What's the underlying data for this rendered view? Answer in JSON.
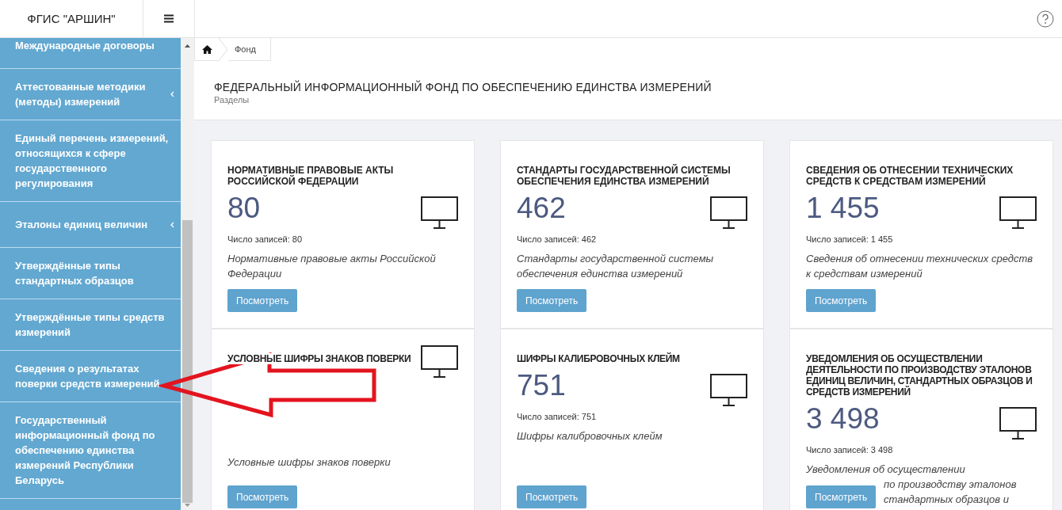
{
  "header": {
    "brand": "ФГИС \"АРШИН\""
  },
  "sidebar": {
    "items": [
      {
        "label": "Международные договоры",
        "has_submenu": false
      },
      {
        "label": "Аттестованные методики (методы) измерений",
        "has_submenu": true
      },
      {
        "label": "Единый перечень измерений, относящихся к сфере государственного регулирования",
        "has_submenu": false
      },
      {
        "label": "Эталоны единиц величин",
        "has_submenu": true
      },
      {
        "label": "Утверждённые типы стандартных образцов",
        "has_submenu": false
      },
      {
        "label": "Утверждённые типы средств измерений",
        "has_submenu": false
      },
      {
        "label": "Сведения о результатах поверки средств измерений",
        "has_submenu": false
      },
      {
        "label": "Государственный информационный фонд по обеспечению единства измерений Республики Беларусь",
        "has_submenu": false
      }
    ]
  },
  "breadcrumb": [
    "Фонд"
  ],
  "page": {
    "title": "ФЕДЕРАЛЬНЫЙ ИНФОРМАЦИОННЫЙ ФОНД ПО ОБЕСПЕЧЕНИЮ ЕДИНСТВА ИЗМЕРЕНИЙ",
    "subtitle": "Разделы"
  },
  "cards": [
    {
      "title": "НОРМАТИВНЫЕ ПРАВОВЫЕ АКТЫ РОССИЙСКОЙ ФЕДЕРАЦИИ",
      "count": "80",
      "records": "Число записей: 80",
      "description": "Нормативные правовые акты Российской Федерации",
      "button": "Посмотреть"
    },
    {
      "title": "СТАНДАРТЫ ГОСУДАРСТВЕННОЙ СИСТЕМЫ ОБЕСПЕЧЕНИЯ ЕДИНСТВА ИЗМЕРЕНИЙ",
      "count": "462",
      "records": "Число записей: 462",
      "description": "Стандарты государственной системы обеспечения единства измерений",
      "button": "Посмотреть"
    },
    {
      "title": "СВЕДЕНИЯ ОБ ОТНЕСЕНИИ ТЕХНИЧЕСКИХ СРЕДСТВ К СРЕДСТВАМ ИЗМЕРЕНИЙ",
      "count": "1 455",
      "records": "Число записей: 1 455",
      "description": "Сведения об отнесении технических средств к средствам измерений",
      "button": "Посмотреть"
    },
    {
      "title": "УСЛОВНЫЕ ШИФРЫ ЗНАКОВ ПОВЕРКИ",
      "description": "Условные шифры знаков поверки",
      "button": "Посмотреть"
    },
    {
      "title": "ШИФРЫ КАЛИБРОВОЧНЫХ КЛЕЙМ",
      "count": "751",
      "records": "Число записей: 751",
      "description": "Шифры калибровочных клейм",
      "button": "Посмотреть"
    },
    {
      "title": "УВЕДОМЛЕНИЯ ОБ ОСУЩЕСТВЛЕНИИ ДЕЯТЕЛЬНОСТИ ПО ПРОИЗВОДСТВУ ЭТАЛОНОВ ЕДИНИЦ ВЕЛИЧИН, СТАНДАРТНЫХ ОБРАЗЦОВ И СРЕДСТВ ИЗМЕРЕНИЙ",
      "count": "3 498",
      "records": "Число записей: 3 498",
      "description": "Уведомления об осуществлении",
      "description_beside_button": [
        "по производству эталонов",
        "стандартных образцов и"
      ],
      "button": "Посмотреть"
    }
  ]
}
